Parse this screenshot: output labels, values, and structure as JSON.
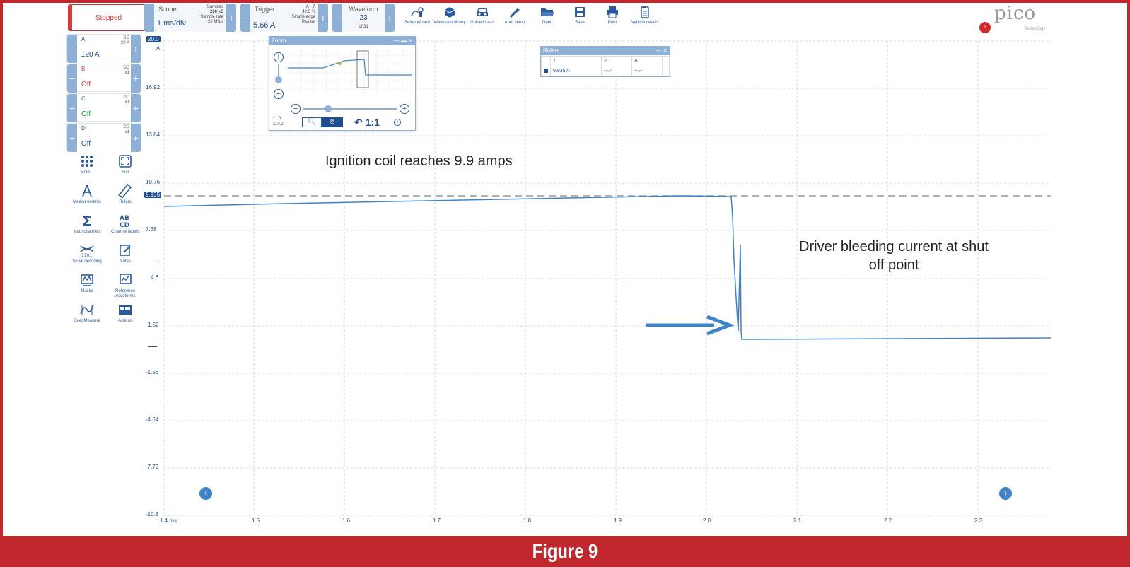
{
  "toolbar": {
    "run_status": "Stopped",
    "scope": {
      "label": "Scope",
      "value": "1 ms/div",
      "samples_label": "Samples",
      "samples_value": "200 kS",
      "rate_label": "Sample rate",
      "rate_value": "20 MS/s"
    },
    "trigger": {
      "label": "Trigger",
      "value": "5.66 A",
      "pct": "42.5 %",
      "mode": "Simple edge",
      "repeat": "Repeat"
    },
    "waveform": {
      "label": "Waveform",
      "value": "23",
      "of": "of 31"
    },
    "tools": [
      {
        "label": "Setup Wizard",
        "icon": "setup-wizard-icon"
      },
      {
        "label": "Waveform library",
        "icon": "waveform-library-icon"
      },
      {
        "label": "Guided tests",
        "icon": "car-icon"
      },
      {
        "label": "Auto setup",
        "icon": "magic-wand-icon"
      },
      {
        "label": "Open",
        "icon": "folder-icon"
      },
      {
        "label": "Save",
        "icon": "floppy-icon"
      },
      {
        "label": "Print",
        "icon": "printer-icon"
      },
      {
        "label": "Vehicle details",
        "icon": "clipboard-icon"
      }
    ],
    "notifications": "1"
  },
  "channels": [
    {
      "name": "A",
      "value": "±20 A",
      "coupling": "DC",
      "probe": "20 A",
      "color": "#1e4e8c"
    },
    {
      "name": "B",
      "value": "Off",
      "coupling": "DC",
      "probe": "x1",
      "color": "#d43a3e"
    },
    {
      "name": "C",
      "value": "Off",
      "coupling": "DC",
      "probe": "x1",
      "color": "#2e8b3a"
    },
    {
      "name": "D",
      "value": "Off",
      "coupling": "DC",
      "probe": "x1",
      "color": "#1e4e8c"
    }
  ],
  "side_tools": [
    {
      "label": "More...",
      "icon": "grid-dots-icon"
    },
    {
      "label": "Full",
      "icon": "fullscreen-icon"
    },
    {
      "label": "Measurements",
      "icon": "compass-icon"
    },
    {
      "label": "Rulers",
      "icon": "ruler-icon"
    },
    {
      "label": "Math channels",
      "icon": "sigma-icon"
    },
    {
      "label": "Channel labels",
      "icon": "abcd-icon"
    },
    {
      "label": "Serial decoding",
      "icon": "serial-icon"
    },
    {
      "label": "Notes",
      "icon": "notes-icon"
    },
    {
      "label": "Masks",
      "icon": "mask-icon"
    },
    {
      "label": "Reference waveforms",
      "icon": "reference-icon"
    },
    {
      "label": "DeepMeasure",
      "icon": "deepmeasure-icon"
    },
    {
      "label": "Actions",
      "icon": "actions-icon"
    }
  ],
  "plot": {
    "y_unit": "A",
    "y_scale_top": "20.0",
    "y_ticks": [
      "16.92",
      "13.84",
      "10.76",
      "7.68",
      "4.6",
      "1.52",
      "-1.56",
      "-4.64",
      "-7.72",
      "-10.8"
    ],
    "x_ticks": [
      "1.4 ms",
      "1.5",
      "1.6",
      "1.7",
      "1.8",
      "1.9",
      "2.0",
      "2.1",
      "2.2",
      "2.3"
    ],
    "ruler_value": "9.935",
    "trace_color": "#3f84c9"
  },
  "zoom": {
    "title": "Zoom",
    "x_factor": "x1.3",
    "y_factor": "x10.2",
    "reset_label": "1:1"
  },
  "rulers": {
    "title": "Rulers",
    "headers": [
      "1",
      "2",
      "Δ"
    ],
    "row": [
      "9.935 A",
      "--.--",
      "--.--"
    ]
  },
  "annotations": {
    "peak": "Ignition coil reaches 9.9 amps",
    "bleed_line1": "Driver bleeding current at shut",
    "bleed_line2": "off point"
  },
  "caption": "Figure 9"
}
